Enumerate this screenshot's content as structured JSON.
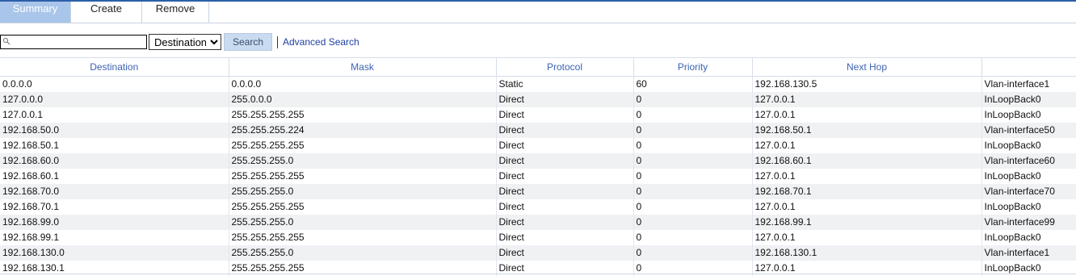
{
  "tabs": [
    {
      "label": "Summary",
      "active": true
    },
    {
      "label": "Create",
      "active": false
    },
    {
      "label": "Remove",
      "active": false
    }
  ],
  "search": {
    "value": "",
    "field_selected": "Destination",
    "field_options": [
      "Destination"
    ],
    "button_label": "Search",
    "advanced_label": "Advanced Search"
  },
  "table": {
    "headers": [
      "Destination",
      "Mask",
      "Protocol",
      "Priority",
      "Next Hop",
      ""
    ],
    "rows": [
      [
        "0.0.0.0",
        "0.0.0.0",
        "Static",
        "60",
        "192.168.130.5",
        "Vlan-interface1"
      ],
      [
        "127.0.0.0",
        "255.0.0.0",
        "Direct",
        "0",
        "127.0.0.1",
        "InLoopBack0"
      ],
      [
        "127.0.0.1",
        "255.255.255.255",
        "Direct",
        "0",
        "127.0.0.1",
        "InLoopBack0"
      ],
      [
        "192.168.50.0",
        "255.255.255.224",
        "Direct",
        "0",
        "192.168.50.1",
        "Vlan-interface50"
      ],
      [
        "192.168.50.1",
        "255.255.255.255",
        "Direct",
        "0",
        "127.0.0.1",
        "InLoopBack0"
      ],
      [
        "192.168.60.0",
        "255.255.255.0",
        "Direct",
        "0",
        "192.168.60.1",
        "Vlan-interface60"
      ],
      [
        "192.168.60.1",
        "255.255.255.255",
        "Direct",
        "0",
        "127.0.0.1",
        "InLoopBack0"
      ],
      [
        "192.168.70.0",
        "255.255.255.0",
        "Direct",
        "0",
        "192.168.70.1",
        "Vlan-interface70"
      ],
      [
        "192.168.70.1",
        "255.255.255.255",
        "Direct",
        "0",
        "127.0.0.1",
        "InLoopBack0"
      ],
      [
        "192.168.99.0",
        "255.255.255.0",
        "Direct",
        "0",
        "192.168.99.1",
        "Vlan-interface99"
      ],
      [
        "192.168.99.1",
        "255.255.255.255",
        "Direct",
        "0",
        "127.0.0.1",
        "InLoopBack0"
      ],
      [
        "192.168.130.0",
        "255.255.255.0",
        "Direct",
        "0",
        "192.168.130.1",
        "Vlan-interface1"
      ],
      [
        "192.168.130.1",
        "255.255.255.255",
        "Direct",
        "0",
        "127.0.0.1",
        "InLoopBack0"
      ]
    ]
  },
  "colors": {
    "accent": "#2b5fa8",
    "tab_active": "#a9c5ea",
    "header_text": "#3c64b4",
    "link": "#1f3fa3",
    "row_alt": "#f0f1f3"
  }
}
